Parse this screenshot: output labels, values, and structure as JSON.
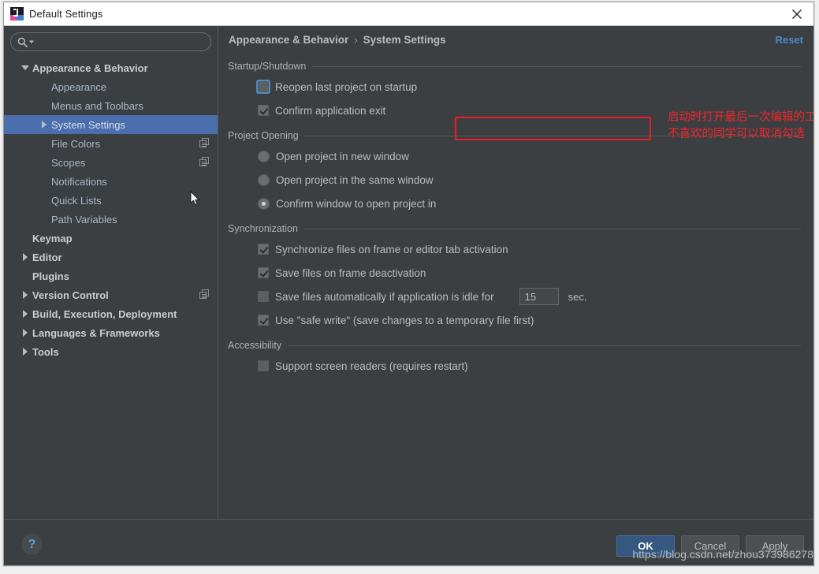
{
  "window": {
    "title": "Default Settings",
    "app_icon": "intellij-idea-icon",
    "close_icon": "close-icon"
  },
  "sidebar": {
    "search": {
      "placeholder": "",
      "value": "",
      "icon": "search-icon",
      "dropdown_icon": "chevron-down-icon"
    },
    "items": [
      {
        "label": "Appearance & Behavior",
        "indent": 0,
        "arrow": "down",
        "bold": true,
        "selected": false,
        "copy_icon": false
      },
      {
        "label": "Appearance",
        "indent": 1,
        "arrow": "none",
        "bold": false,
        "selected": false,
        "copy_icon": false
      },
      {
        "label": "Menus and Toolbars",
        "indent": 1,
        "arrow": "none",
        "bold": false,
        "selected": false,
        "copy_icon": false
      },
      {
        "label": "System Settings",
        "indent": 1,
        "arrow": "right",
        "bold": false,
        "selected": true,
        "copy_icon": false
      },
      {
        "label": "File Colors",
        "indent": 1,
        "arrow": "none",
        "bold": false,
        "selected": false,
        "copy_icon": true
      },
      {
        "label": "Scopes",
        "indent": 1,
        "arrow": "none",
        "bold": false,
        "selected": false,
        "copy_icon": true
      },
      {
        "label": "Notifications",
        "indent": 1,
        "arrow": "none",
        "bold": false,
        "selected": false,
        "copy_icon": false
      },
      {
        "label": "Quick Lists",
        "indent": 1,
        "arrow": "none",
        "bold": false,
        "selected": false,
        "copy_icon": false
      },
      {
        "label": "Path Variables",
        "indent": 1,
        "arrow": "none",
        "bold": false,
        "selected": false,
        "copy_icon": false
      },
      {
        "label": "Keymap",
        "indent": 0,
        "arrow": "none",
        "bold": true,
        "selected": false,
        "copy_icon": false
      },
      {
        "label": "Editor",
        "indent": 0,
        "arrow": "right",
        "bold": true,
        "selected": false,
        "copy_icon": false
      },
      {
        "label": "Plugins",
        "indent": 0,
        "arrow": "none",
        "bold": true,
        "selected": false,
        "copy_icon": false
      },
      {
        "label": "Version Control",
        "indent": 0,
        "arrow": "right",
        "bold": true,
        "selected": false,
        "copy_icon": true
      },
      {
        "label": "Build, Execution, Deployment",
        "indent": 0,
        "arrow": "right",
        "bold": true,
        "selected": false,
        "copy_icon": false
      },
      {
        "label": "Languages & Frameworks",
        "indent": 0,
        "arrow": "right",
        "bold": true,
        "selected": false,
        "copy_icon": false
      },
      {
        "label": "Tools",
        "indent": 0,
        "arrow": "right",
        "bold": true,
        "selected": false,
        "copy_icon": false
      }
    ]
  },
  "breadcrumb": {
    "parent": "Appearance & Behavior",
    "separator": "›",
    "current": "System Settings",
    "reset_label": "Reset"
  },
  "sections": {
    "startup": {
      "title": "Startup/Shutdown",
      "options": [
        {
          "label": "Reopen last project on startup",
          "type": "checkbox",
          "checked": false,
          "focused": true
        },
        {
          "label": "Confirm application exit",
          "type": "checkbox",
          "checked": true,
          "focused": false
        }
      ]
    },
    "project_opening": {
      "title": "Project Opening",
      "options": [
        {
          "label": "Open project in new window",
          "type": "radio",
          "selected": false
        },
        {
          "label": "Open project in the same window",
          "type": "radio",
          "selected": false
        },
        {
          "label": "Confirm window to open project in",
          "type": "radio",
          "selected": true
        }
      ]
    },
    "synchronization": {
      "title": "Synchronization",
      "options": [
        {
          "label": "Synchronize files on frame or editor tab activation",
          "type": "checkbox",
          "checked": true
        },
        {
          "label": "Save files on frame deactivation",
          "type": "checkbox",
          "checked": true
        },
        {
          "label": "Save files automatically if application is idle for",
          "type": "checkbox",
          "checked": false,
          "field_value": "15",
          "unit": "sec."
        },
        {
          "label": "Use \"safe write\" (save changes to a temporary file first)",
          "type": "checkbox",
          "checked": true
        }
      ]
    },
    "accessibility": {
      "title": "Accessibility",
      "options": [
        {
          "label": "Support screen readers (requires restart)",
          "type": "checkbox",
          "checked": false
        }
      ]
    }
  },
  "annotation": {
    "line1": "启动时打开最后一次编辑的工程。",
    "line2": "不喜欢的同学可以取消勾选",
    "color": "#f0252b"
  },
  "footer": {
    "help_label": "?",
    "ok_label": "OK",
    "cancel_label": "Cancel",
    "apply_label": "Apply"
  },
  "watermark": {
    "text": "https://blog.csdn.net/zhou373986278"
  },
  "colors": {
    "window_bg": "#3c3f41",
    "selection": "#4b6eaf",
    "link": "#4a88c7",
    "primary_button": "#365880",
    "annotation_red": "#f0252b"
  }
}
